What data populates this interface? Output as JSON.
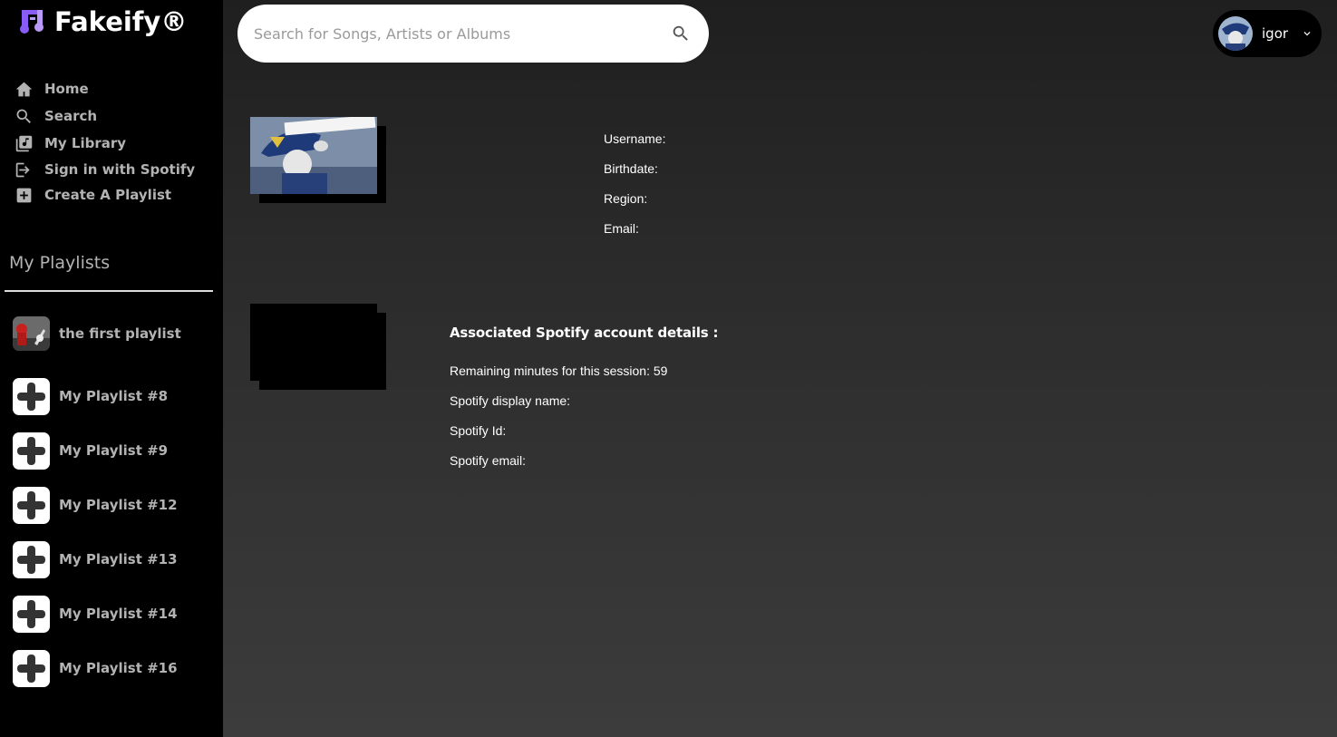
{
  "app": {
    "name": "Fakeify®"
  },
  "sidebar": {
    "nav": [
      {
        "label": "Home",
        "icon": "home-icon"
      },
      {
        "label": "Search",
        "icon": "search-icon"
      },
      {
        "label": "My Library",
        "icon": "library-icon"
      },
      {
        "label": "Sign in with Spotify",
        "icon": "sign-in-icon"
      },
      {
        "label": "Create A Playlist",
        "icon": "add-box-icon"
      }
    ],
    "playlists_heading": "My Playlists",
    "playlists": [
      {
        "name": "the first playlist",
        "thumb": "playlist-cover-image"
      },
      {
        "name": "My Playlist #8",
        "thumb": "plus-icon"
      },
      {
        "name": "My Playlist #9",
        "thumb": "plus-icon"
      },
      {
        "name": "My Playlist #12",
        "thumb": "plus-icon"
      },
      {
        "name": "My Playlist #13",
        "thumb": "plus-icon"
      },
      {
        "name": "My Playlist #14",
        "thumb": "plus-icon"
      },
      {
        "name": "My Playlist #16",
        "thumb": "plus-icon"
      }
    ]
  },
  "search": {
    "placeholder": "Search for Songs, Artists or Albums"
  },
  "user": {
    "name": "igor"
  },
  "profile": {
    "username_label": "Username:",
    "birthdate_label": "Birthdate:",
    "region_label": "Region:",
    "email_label": "Email:"
  },
  "spotify": {
    "heading": "Associated Spotify account details :",
    "remaining_label": "Remaining minutes for this session: 59",
    "display_name_label": "Spotify display name:",
    "id_label": "Spotify Id:",
    "email_label": "Spotify email:"
  },
  "colors": {
    "sidebar_bg": "#000000",
    "logo_accent": "#8a5cf6",
    "text_muted": "#b3b3b3"
  }
}
